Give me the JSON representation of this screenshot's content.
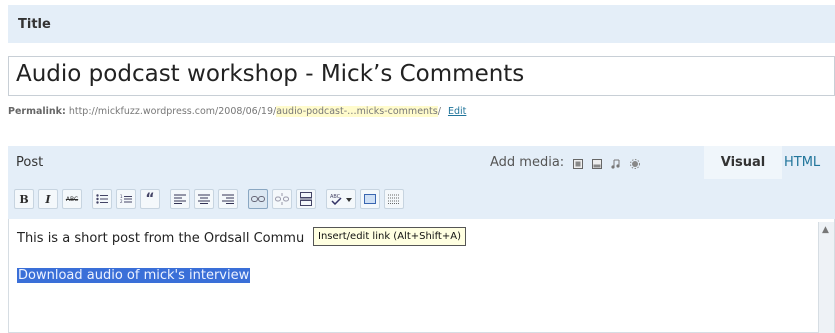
{
  "title_section": {
    "label": "Title",
    "value": "Audio podcast workshop - Mick’s Comments"
  },
  "permalink": {
    "label": "Permalink:",
    "base": "http://mickfuzz.wordpress.com/2008/06/19/",
    "slug": "audio-podcast-…micks-comments",
    "after_slug": "/",
    "edit_label": "Edit"
  },
  "post": {
    "label": "Post",
    "add_media_label": "Add media:",
    "media_icons": [
      "image-icon",
      "video-icon",
      "audio-icon",
      "media-gear-icon"
    ],
    "tabs": {
      "visual": "Visual",
      "html": "HTML"
    }
  },
  "toolbar": {
    "buttons": [
      {
        "name": "bold-button",
        "glyph": "B"
      },
      {
        "name": "italic-button",
        "glyph": "I"
      },
      {
        "name": "strikethrough-button",
        "glyph": "ABC"
      },
      {
        "name": "bullet-list-button",
        "glyph": "☰"
      },
      {
        "name": "numbered-list-button",
        "glyph": "☰"
      },
      {
        "name": "blockquote-button",
        "glyph": "“"
      },
      {
        "name": "align-left-button",
        "glyph": "≡"
      },
      {
        "name": "align-center-button",
        "glyph": "≡"
      },
      {
        "name": "align-right-button",
        "glyph": "≡"
      },
      {
        "name": "insert-link-button",
        "glyph": "∞"
      },
      {
        "name": "unlink-button",
        "glyph": "✂"
      },
      {
        "name": "insert-more-button",
        "glyph": "⊟"
      },
      {
        "name": "spellcheck-button",
        "glyph": "✔"
      },
      {
        "name": "fullscreen-button",
        "glyph": "▭"
      },
      {
        "name": "kitchen-sink-button",
        "glyph": "▤"
      }
    ]
  },
  "editor": {
    "line1": "This is a short post from the Ordsall Commu",
    "link_text": "Download audio of mick's interview",
    "tooltip": "Insert/edit link (Alt+Shift+A)"
  }
}
